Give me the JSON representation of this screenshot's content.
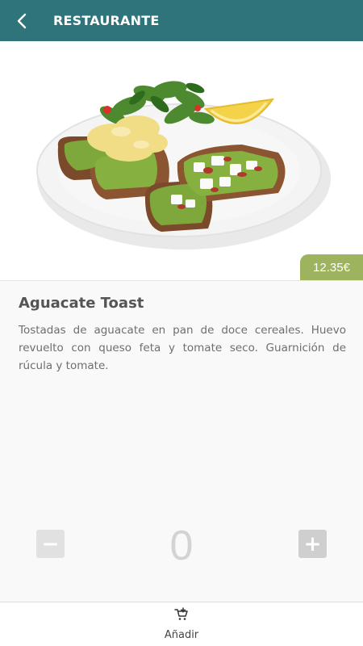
{
  "header": {
    "title": "RESTAURANTE",
    "back_icon": "chevron-left-icon"
  },
  "product": {
    "name": "Aguacate Toast",
    "price": "12.35€",
    "description": "Tostadas de aguacate en pan de doce cereales. Huevo revuelto con queso feta y tomate seco. Guarnición de rúcula y tomate.",
    "image": "avocado-toast-plate-image"
  },
  "quantity": {
    "value": "0",
    "minus_label": "−",
    "plus_label": "+"
  },
  "footer": {
    "add_label": "Añadir",
    "add_icon": "add-to-cart-icon"
  },
  "colors": {
    "header_bg": "#2e747a",
    "price_bg": "#9db35e"
  }
}
